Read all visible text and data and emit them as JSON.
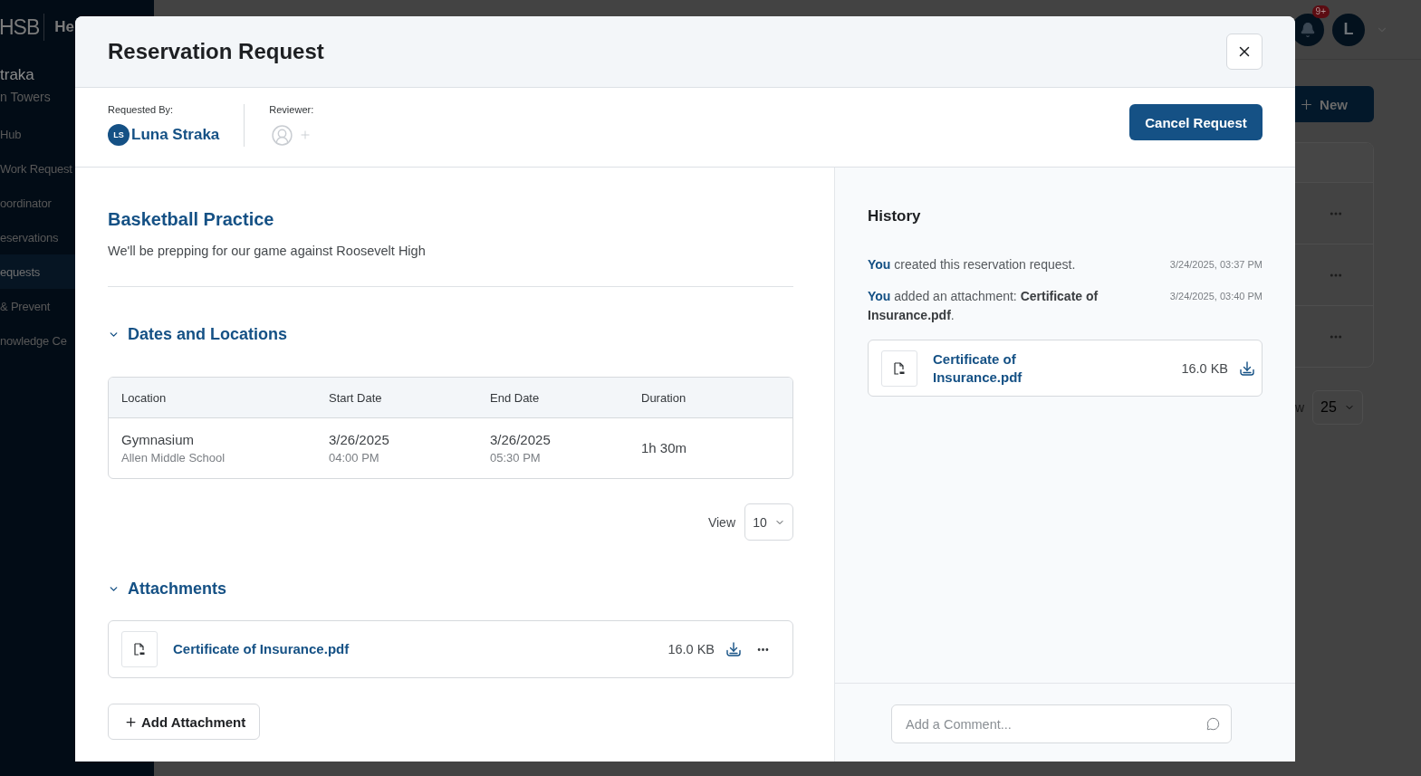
{
  "background": {
    "sidebar": {
      "logo": "HSB",
      "app_name": "He",
      "user_name": "traka",
      "user_site": "n Towers",
      "items": [
        {
          "label": "Hub",
          "selected": false
        },
        {
          "label": "Work Request",
          "selected": false
        },
        {
          "label": "oordinator",
          "selected": false
        },
        {
          "label": "eservations",
          "selected": false
        },
        {
          "label": "equests",
          "selected": true
        },
        {
          "label": "& Prevent",
          "selected": false
        },
        {
          "label": "nowledge Ce",
          "selected": false
        }
      ]
    },
    "notifications_badge": "9+",
    "account_avatar": "L",
    "new_button": "New",
    "pagination": {
      "label": "w",
      "page_size": "25"
    }
  },
  "modal": {
    "title": "Reservation Request",
    "requested_by": {
      "label": "Requested By:",
      "initials": "LS",
      "name": "Luna Straka"
    },
    "reviewer": {
      "label": "Reviewer:"
    },
    "cancel_button": "Cancel Request",
    "event": {
      "title": "Basketball Practice",
      "description": "We'll be prepping for our game against Roosevelt High"
    },
    "dates_section": {
      "title": "Dates and Locations",
      "expanded": true,
      "columns": [
        "Location",
        "Start Date",
        "End Date",
        "Duration"
      ],
      "rows": [
        [
          {
            "primary": "Gymnasium",
            "secondary": "Allen Middle School"
          },
          {
            "primary": "3/26/2025",
            "secondary": "04:00 PM"
          },
          {
            "primary": "3/26/2025",
            "secondary": "05:30 PM"
          },
          {
            "primary": "1h 30m"
          }
        ]
      ],
      "view_label": "View",
      "page_size": "10"
    },
    "attachments_section": {
      "title": "Attachments",
      "expanded": true,
      "files": [
        {
          "name": "Certificate of Insurance.pdf",
          "size": "16.0 KB"
        }
      ],
      "add_button": "Add Attachment"
    },
    "history": {
      "title": "History",
      "entries": [
        {
          "actor": "You",
          "text": "created this reservation request.",
          "time": "3/24/2025, 03:37 PM"
        },
        {
          "actor": "You",
          "text": "added an attachment: **Certificate of Insurance.pdf**.",
          "time": "3/24/2025, 03:40 PM",
          "file": {
            "name": "Certificate of Insurance.pdf",
            "size": "16.0 KB"
          }
        }
      ]
    },
    "comment": {
      "placeholder": "Add a Comment..."
    }
  }
}
